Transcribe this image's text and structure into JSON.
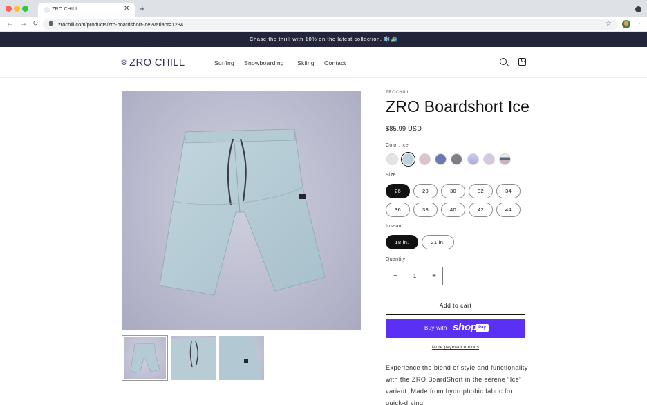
{
  "browser": {
    "tab_title": "ZRO CHILL",
    "url": "zrochill.com/products/zro-boardshort-ice?variant=1234",
    "icons": [
      "back-icon",
      "forward-icon",
      "reload-icon",
      "lock-icon",
      "star-icon",
      "menu-icon"
    ]
  },
  "announcement": "Chase the thrill with 10% on the latest collection. ❄️🏄",
  "header": {
    "logo": "ZRO CHILL",
    "nav": [
      "Surfing",
      "Snowboarding",
      "Skiing",
      "Contact"
    ]
  },
  "product": {
    "vendor": "ZROCHILL",
    "title": "ZRO Boardshort Ice",
    "price": "$85.99 USD",
    "color_label": "Color: Ice",
    "colors": [
      {
        "name": "white",
        "hex": "#e4e4e4"
      },
      {
        "name": "ice",
        "hex": "#b8d4dc"
      },
      {
        "name": "pink",
        "hex": "#dcc2cf"
      },
      {
        "name": "blue",
        "hex": "#6c78b0"
      },
      {
        "name": "gray",
        "hex": "#7c7f86"
      },
      {
        "name": "periwinkle",
        "hex": "#a8aedd"
      },
      {
        "name": "lilac",
        "hex": "#d7c8e0"
      },
      {
        "name": "mix",
        "hex": "#4f6b73"
      }
    ],
    "selected_color": "ice",
    "size_label": "Size",
    "sizes": [
      "26",
      "28",
      "30",
      "32",
      "34",
      "36",
      "38",
      "40",
      "42",
      "44"
    ],
    "selected_size": "26",
    "inseam_label": "Inseam",
    "inseams": [
      "18 in.",
      "21 in."
    ],
    "selected_inseam": "18 in.",
    "quantity_label": "Quantity",
    "quantity": "1",
    "qty_minus": "−",
    "qty_plus": "+",
    "add_to_cart": "Add to cart",
    "buy_with": "Buy with",
    "shop": "shop",
    "pay": "Pay",
    "more_payment": "More payment options",
    "description": "Experience the blend of style and functionality with the ZRO BoardShort in the serene \"Ice\" variant. Made from hydrophobic fabric for quick-drying"
  }
}
